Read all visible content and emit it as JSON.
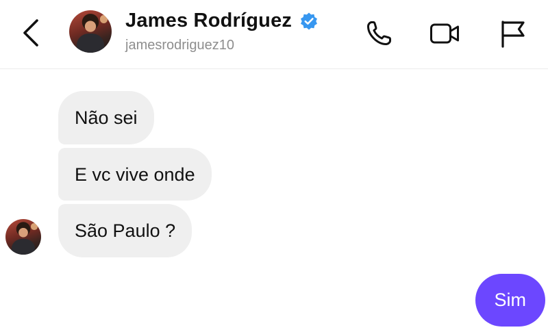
{
  "header": {
    "contact_name": "James Rodríguez",
    "username": "jamesrodriguez10",
    "verified": true,
    "icons": [
      "chevron-left-icon",
      "phone-icon",
      "video-camera-icon",
      "flag-icon"
    ]
  },
  "messages": [
    {
      "from": "contact",
      "text": "Não sei"
    },
    {
      "from": "contact",
      "text": "E vc vive onde"
    },
    {
      "from": "contact",
      "text": "São Paulo ?"
    },
    {
      "from": "me",
      "text": "Sim"
    }
  ],
  "colors": {
    "sent_bubble": "#6c47ff",
    "received_bubble": "#efefef",
    "verified_badge": "#3797f0",
    "username": "#8e8e8e"
  }
}
